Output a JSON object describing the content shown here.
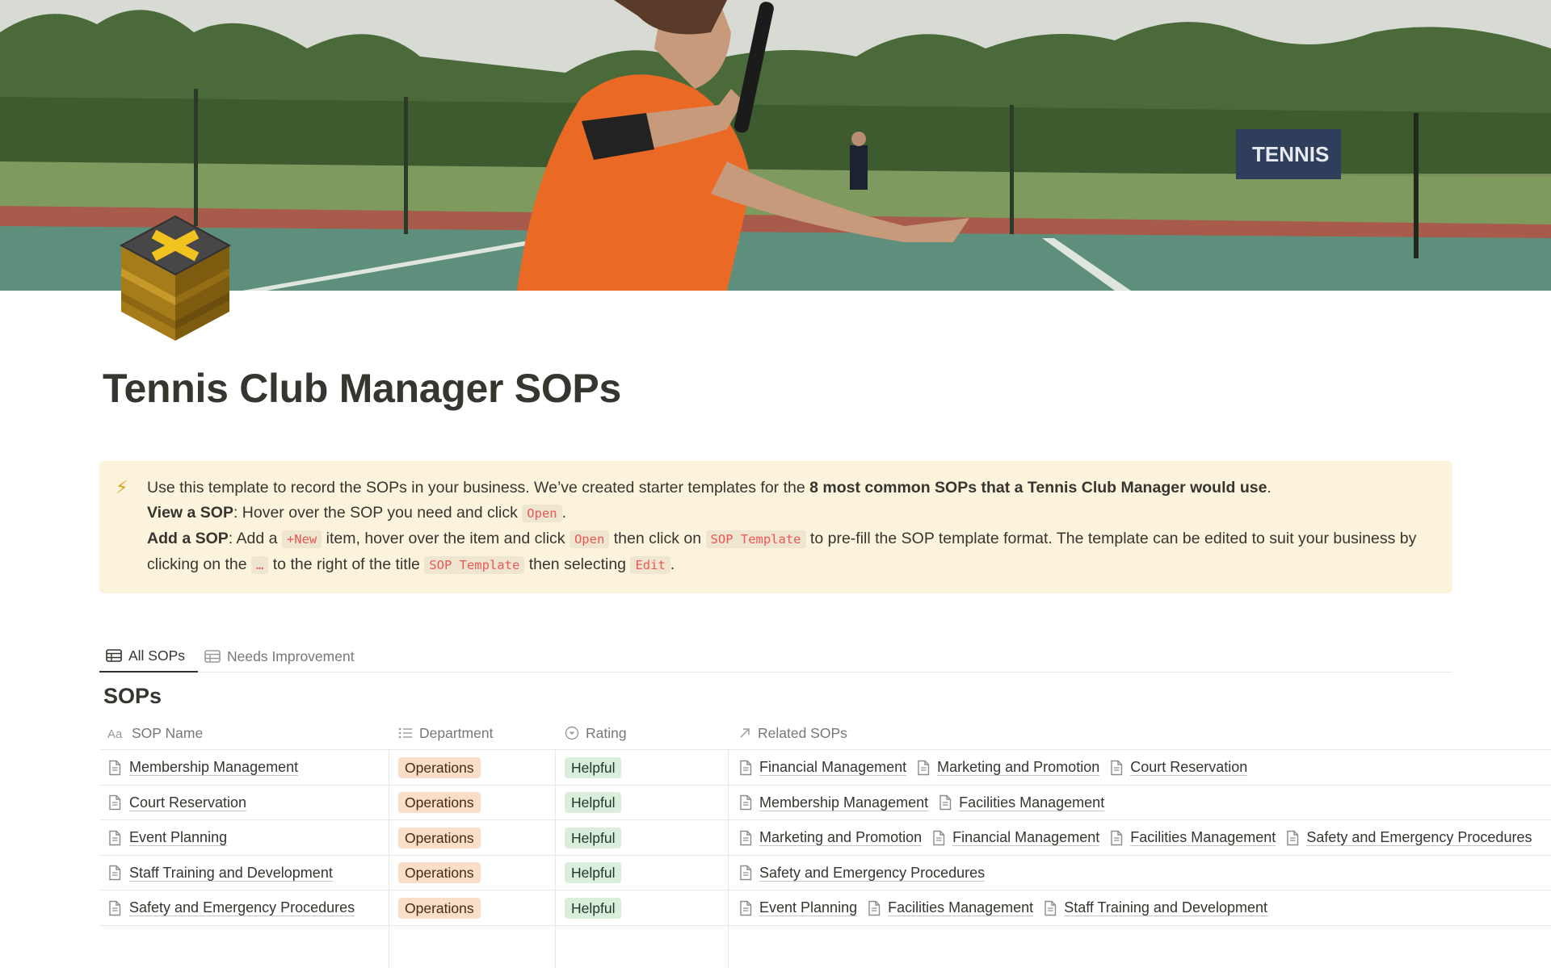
{
  "page": {
    "title": "Tennis Club Manager SOPs",
    "cover_icon": "tennis-court-photo",
    "page_icon": "crate-box-icon"
  },
  "callout": {
    "icon": "lightning-icon",
    "line1_pre": "Use this template to record the SOPs in your business. We’ve created starter templates for the ",
    "line1_bold": "8 most common SOPs that a Tennis Club Manager would use",
    "line1_post": ".",
    "view_label": "View a SOP",
    "view_text": ": Hover over the SOP you need and click ",
    "view_code": "Open",
    "view_end": ".",
    "add_label": "Add a SOP",
    "add_text1": ": Add a ",
    "add_code_new": "+New",
    "add_text2": " item, hover over the item and click ",
    "add_code_open": "Open",
    "add_text3": " then click on ",
    "add_code_tpl": "SOP Template",
    "add_text4": " to pre-fill the SOP template format. The template can be edited to suit your business by clicking on the ",
    "add_code_dots": "…",
    "add_text5": " to the right of the title ",
    "add_code_tpl2": "SOP Template",
    "add_text6": " then selecting ",
    "add_code_edit": "Edit",
    "add_end": "."
  },
  "tabs": [
    {
      "label": "All SOPs",
      "active": true
    },
    {
      "label": "Needs Improvement",
      "active": false
    }
  ],
  "database": {
    "title": "SOPs",
    "columns": {
      "name": "SOP Name",
      "department": "Department",
      "rating": "Rating",
      "related": "Related SOPs"
    },
    "rows": [
      {
        "name": "Membership Management",
        "department": "Operations",
        "rating": "Helpful",
        "related": [
          "Financial Management",
          "Marketing and Promotion",
          "Court Reservation"
        ]
      },
      {
        "name": "Court Reservation",
        "department": "Operations",
        "rating": "Helpful",
        "related": [
          "Membership Management",
          "Facilities Management"
        ]
      },
      {
        "name": "Event Planning",
        "department": "Operations",
        "rating": "Helpful",
        "related": [
          "Marketing and Promotion",
          "Financial Management",
          "Facilities Management",
          "Safety and Emergency Procedures"
        ]
      },
      {
        "name": "Staff Training and Development",
        "department": "Operations",
        "rating": "Helpful",
        "related": [
          "Safety and Emergency Procedures"
        ]
      },
      {
        "name": "Safety and Emergency Procedures",
        "department": "Operations",
        "rating": "Helpful",
        "related": [
          "Event Planning",
          "Facilities Management",
          "Staff Training and Development"
        ]
      }
    ]
  },
  "colors": {
    "callout_bg": "#fbf3db",
    "dept_tag_bg": "#fadec9",
    "rating_tag_bg": "#dbeddb",
    "code_text": "#eb5757"
  }
}
